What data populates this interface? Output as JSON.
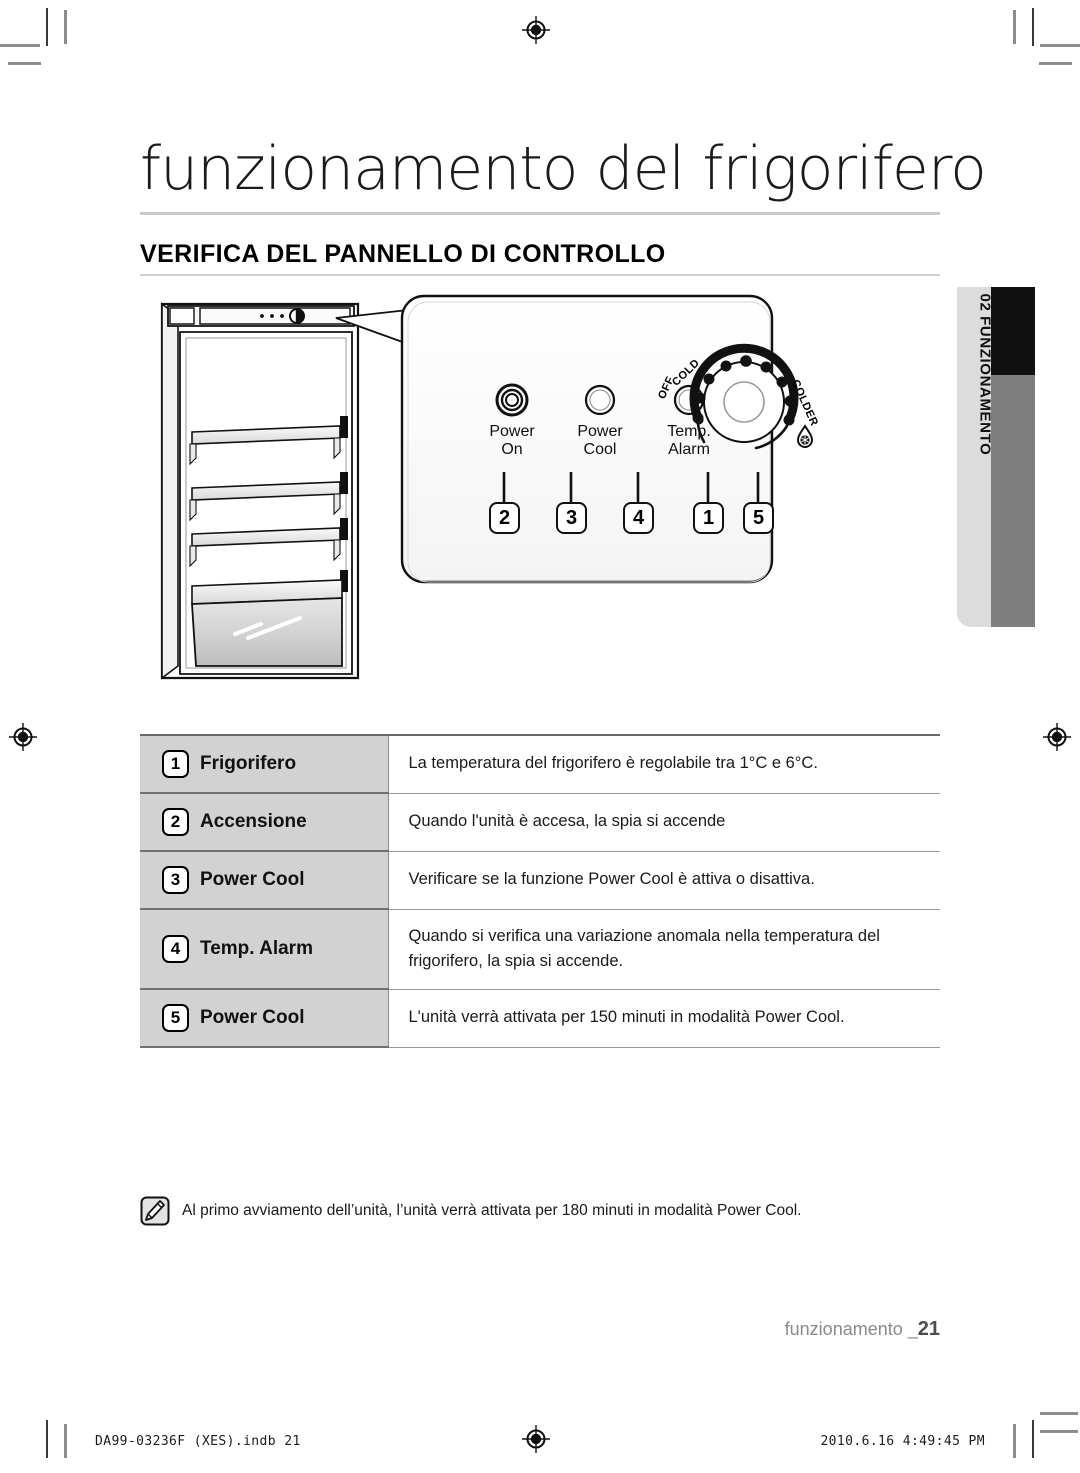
{
  "header": {
    "chapter_title": "funzionamento del frigorifero",
    "section_title": "VERIFICA DEL PANNELLO DI CONTROLLO"
  },
  "side_tab": {
    "label": "02 FUNZIONAMENTO"
  },
  "control_panel": {
    "indicators": [
      {
        "line1": "Power",
        "line2": "On",
        "callout": "2",
        "lit": true
      },
      {
        "line1": "Power",
        "line2": "Cool",
        "callout": "3",
        "lit": false
      },
      {
        "line1": "Temp.",
        "line2": "Alarm",
        "callout": "4",
        "lit": false
      }
    ],
    "dial": {
      "label_off": "OFF",
      "label_cold": "COLD",
      "label_colder": "COLDER",
      "callout_dial": "1",
      "callout_powercool": "5",
      "snowflake_icon": "snowflake-droplet-icon"
    }
  },
  "table": {
    "rows": [
      {
        "num": "1",
        "label": "Frigorifero",
        "desc": "La temperatura del frigorifero è regolabile tra 1°C e 6°C."
      },
      {
        "num": "2",
        "label": "Accensione",
        "desc": "Quando l'unità è accesa, la spia si accende"
      },
      {
        "num": "3",
        "label": "Power Cool",
        "desc": "Verificare se la funzione Power Cool è attiva o disattiva."
      },
      {
        "num": "4",
        "label": "Temp. Alarm",
        "desc": "Quando si verifica una variazione anomala nella temperatura del frigorifero, la spia si accende."
      },
      {
        "num": "5",
        "label": "Power Cool",
        "desc": "L'unità verrà attivata per 150 minuti in modalità Power Cool."
      }
    ]
  },
  "note": {
    "icon": "note-pen-icon",
    "text": "Al primo avviamento dell’unità, l’unità verrà attivata per 180 minuti in modalità Power Cool."
  },
  "footer": {
    "page_label": "funzionamento _",
    "page_number": "21",
    "print_left": "DA99-03236F (XES).indb   21",
    "print_right": "2010.6.16   4:49:45 PM"
  },
  "colors": {
    "table_label_bg": "#d2d2d2",
    "side_tab_grey": "#7e7e7e",
    "side_tab_black": "#111111",
    "rule_grey": "#c9c9c9"
  }
}
